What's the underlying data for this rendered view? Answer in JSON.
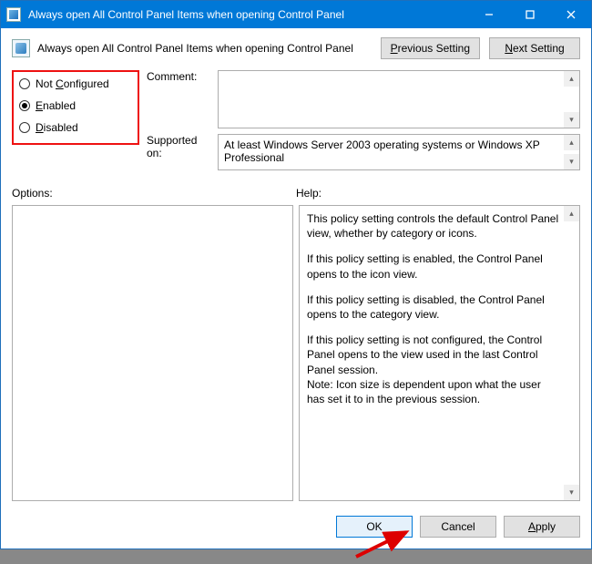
{
  "titlebar": {
    "title": "Always open All Control Panel Items when opening Control Panel"
  },
  "header": {
    "policy_title": "Always open All Control Panel Items when opening Control Panel",
    "prev_btn": "Previous Setting",
    "next_btn": "Next Setting"
  },
  "radios": {
    "not_configured": "Not Configured",
    "enabled": "Enabled",
    "disabled": "Disabled",
    "selected": "enabled"
  },
  "labels": {
    "comment": "Comment:",
    "supported": "Supported on:",
    "options": "Options:",
    "help": "Help:"
  },
  "fields": {
    "comment_value": "",
    "supported_value": "At least Windows Server 2003 operating systems or Windows XP Professional"
  },
  "help": {
    "p1": "This policy setting controls the default Control Panel view, whether by category or icons.",
    "p2": "If this policy setting is enabled, the Control Panel opens to the icon view.",
    "p3": "If this policy setting is disabled, the Control Panel opens to the category view.",
    "p4": "If this policy setting is not configured, the Control Panel opens to the view used in the last Control Panel session.",
    "p5": "Note: Icon size is dependent upon what the user has set it to in the previous session."
  },
  "footer": {
    "ok": "OK",
    "cancel": "Cancel",
    "apply": "Apply"
  }
}
